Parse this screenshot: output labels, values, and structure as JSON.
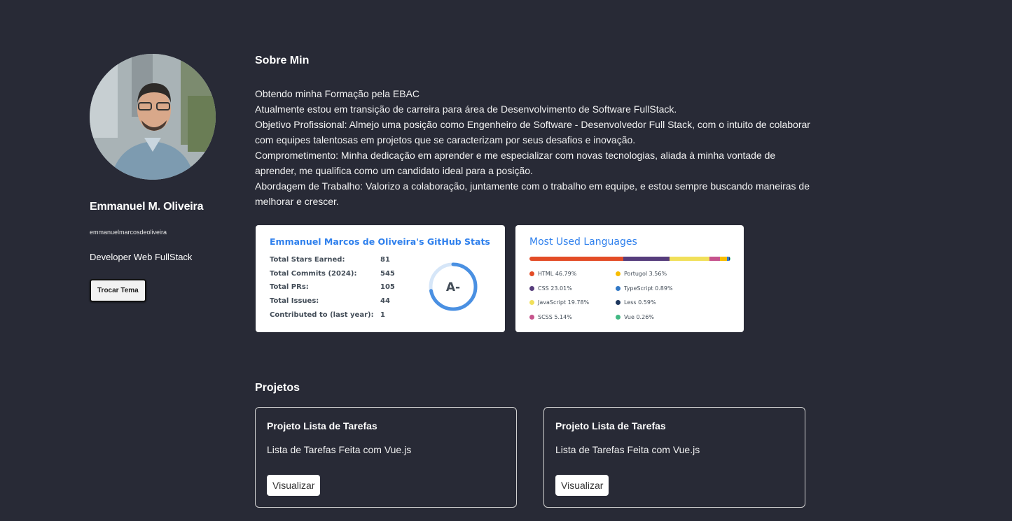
{
  "profile": {
    "name": "Emmanuel M. Oliveira",
    "username": "emmanuelmarcosdeoliveira",
    "role": "Developer Web FullStack",
    "theme_button": "Trocar Tema"
  },
  "about": {
    "title": "Sobre Min",
    "lines": [
      "Obtendo minha Formação pela EBAC",
      "Atualmente estou em transição de carreira para área de Desenvolvimento de Software FullStack.",
      "Objetivo Profissional: Almejo uma posição como Engenheiro de Software - Desenvolvedor Full Stack, com o intuito de colaborar com equipes talentosas em projetos que se caracterizam por seus desafios e inovação.",
      "Comprometimento: Minha dedicação em aprender e me especializar com novas tecnologias, aliada à minha vontade de aprender, me qualifica como um candidato ideal para a posição.",
      "Abordagem de Trabalho: Valorizo a colaboração, juntamente com o trabalho em equipe, e estou sempre buscando maneiras de melhorar e crescer."
    ]
  },
  "github_stats": {
    "title": "Emmanuel Marcos de Oliveira's GitHub Stats",
    "rows": [
      {
        "label": "Total Stars Earned:",
        "value": "81"
      },
      {
        "label": "Total Commits (2024):",
        "value": "545"
      },
      {
        "label": "Total PRs:",
        "value": "105"
      },
      {
        "label": "Total Issues:",
        "value": "44"
      },
      {
        "label": "Contributed to (last year):",
        "value": "1"
      }
    ],
    "rank": "A-",
    "rank_progress": 0.72,
    "accent": "#2f80ed",
    "ring_color": "#4a90e2",
    "ring_bg": "#d6e6f8"
  },
  "languages": {
    "title": "Most Used Languages",
    "items": [
      {
        "name": "HTML",
        "percent": "46.79%",
        "value": 46.79,
        "color": "#e34c26"
      },
      {
        "name": "CSS",
        "percent": "23.01%",
        "value": 23.01,
        "color": "#563d7c"
      },
      {
        "name": "JavaScript",
        "percent": "19.78%",
        "value": 19.78,
        "color": "#f1e05a"
      },
      {
        "name": "SCSS",
        "percent": "5.14%",
        "value": 5.14,
        "color": "#c6538c"
      },
      {
        "name": "Portugol",
        "percent": "3.56%",
        "value": 3.56,
        "color": "#f8bd00"
      },
      {
        "name": "TypeScript",
        "percent": "0.89%",
        "value": 0.89,
        "color": "#3178c6"
      },
      {
        "name": "Less",
        "percent": "0.59%",
        "value": 0.59,
        "color": "#1d365d"
      },
      {
        "name": "Vue",
        "percent": "0.26%",
        "value": 0.26,
        "color": "#41b883"
      }
    ]
  },
  "projects": {
    "title": "Projetos",
    "items": [
      {
        "name": "Projeto Lista de Tarefas",
        "description": "Lista de Tarefas Feita com Vue.js",
        "button": "Visualizar"
      },
      {
        "name": "Projeto Lista de Tarefas",
        "description": "Lista de Tarefas Feita com Vue.js",
        "button": "Visualizar"
      }
    ]
  },
  "colors": {
    "background": "#282a36",
    "card": "#ffffff",
    "link_blue": "#2f80ed"
  }
}
